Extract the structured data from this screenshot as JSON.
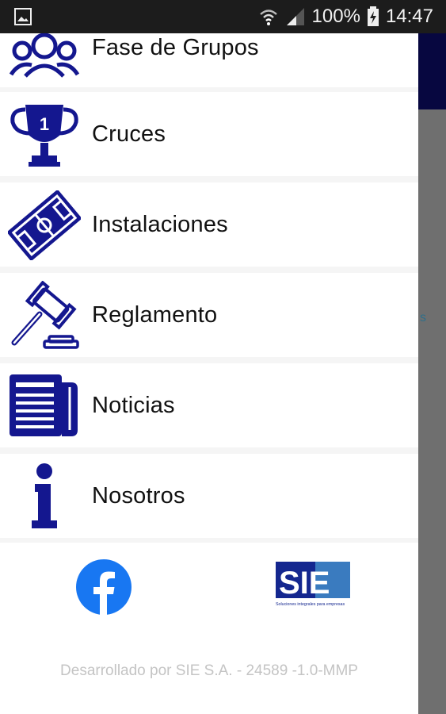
{
  "status_bar": {
    "battery": "100%",
    "time": "14:47"
  },
  "drawer": {
    "items": [
      {
        "label": "Fase de Grupos",
        "icon": "groups-icon"
      },
      {
        "label": "Cruces",
        "icon": "trophy-icon"
      },
      {
        "label": "Instalaciones",
        "icon": "field-icon"
      },
      {
        "label": "Reglamento",
        "icon": "gavel-icon"
      },
      {
        "label": "Noticias",
        "icon": "newspaper-icon"
      },
      {
        "label": "Nosotros",
        "icon": "info-icon"
      }
    ],
    "footer": {
      "facebook_icon": "facebook-icon",
      "logo_text": "SIE",
      "logo_tagline": "Soluciones integrales para empresas",
      "credit": "Desarrollado por SIE S.A. - 24589 -1.0-MMP"
    }
  },
  "colors": {
    "icon_blue": "#14178f",
    "facebook_blue": "#1877f2",
    "appbar": "#070740",
    "scrim": "#6f6f6f"
  }
}
